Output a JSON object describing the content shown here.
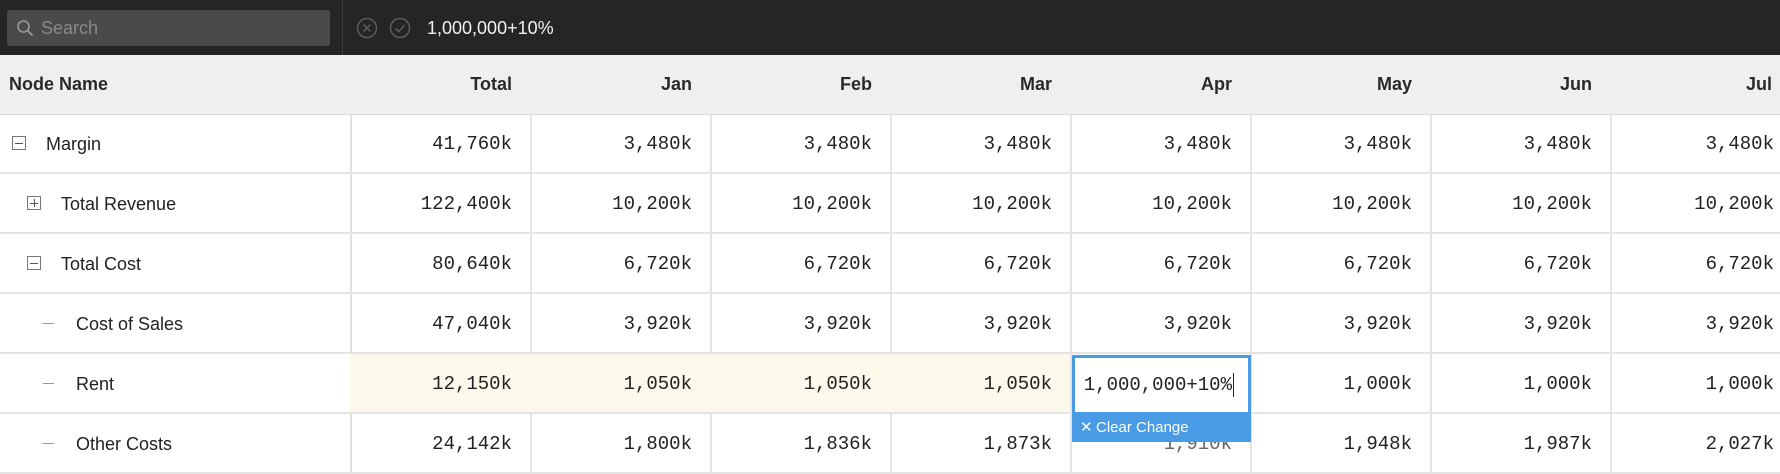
{
  "toolbar": {
    "search_placeholder": "Search",
    "formula_value": "1,000,000+10%",
    "cancel_icon": "circle-x-icon",
    "confirm_icon": "circle-check-icon"
  },
  "grid": {
    "columns": [
      "Node Name",
      "Total",
      "Jan",
      "Feb",
      "Mar",
      "Apr",
      "May",
      "Jun",
      "Jul"
    ],
    "rows": [
      {
        "name": "Margin",
        "toggle": "collapse",
        "values": [
          "41,760k",
          "3,480k",
          "3,480k",
          "3,480k",
          "3,480k",
          "3,480k",
          "3,480k",
          "3,480k"
        ]
      },
      {
        "name": "Total Revenue",
        "toggle": "expand",
        "values": [
          "122,400k",
          "10,200k",
          "10,200k",
          "10,200k",
          "10,200k",
          "10,200k",
          "10,200k",
          "10,200k"
        ]
      },
      {
        "name": "Total Cost",
        "toggle": "collapse",
        "values": [
          "80,640k",
          "6,720k",
          "6,720k",
          "6,720k",
          "6,720k",
          "6,720k",
          "6,720k",
          "6,720k"
        ]
      },
      {
        "name": "Cost of Sales",
        "toggle": "leaf",
        "values": [
          "47,040k",
          "3,920k",
          "3,920k",
          "3,920k",
          "3,920k",
          "3,920k",
          "3,920k",
          "3,920k"
        ]
      },
      {
        "name": "Rent",
        "toggle": "leaf",
        "values": [
          "12,150k",
          "1,050k",
          "1,050k",
          "1,050k",
          "1,000,000+10%",
          "1,000k",
          "1,000k",
          "1,000k"
        ]
      },
      {
        "name": "Other Costs",
        "toggle": "leaf",
        "values": [
          "24,142k",
          "1,800k",
          "1,836k",
          "1,873k",
          "1,910k",
          "1,948k",
          "1,987k",
          "2,027k"
        ]
      }
    ]
  },
  "editor": {
    "value": "1,000,000+10%",
    "clear_label": "Clear Change"
  },
  "colors": {
    "accent": "#4a9be5",
    "changed_cell": "#fdf9ea",
    "topbar": "#252525"
  }
}
